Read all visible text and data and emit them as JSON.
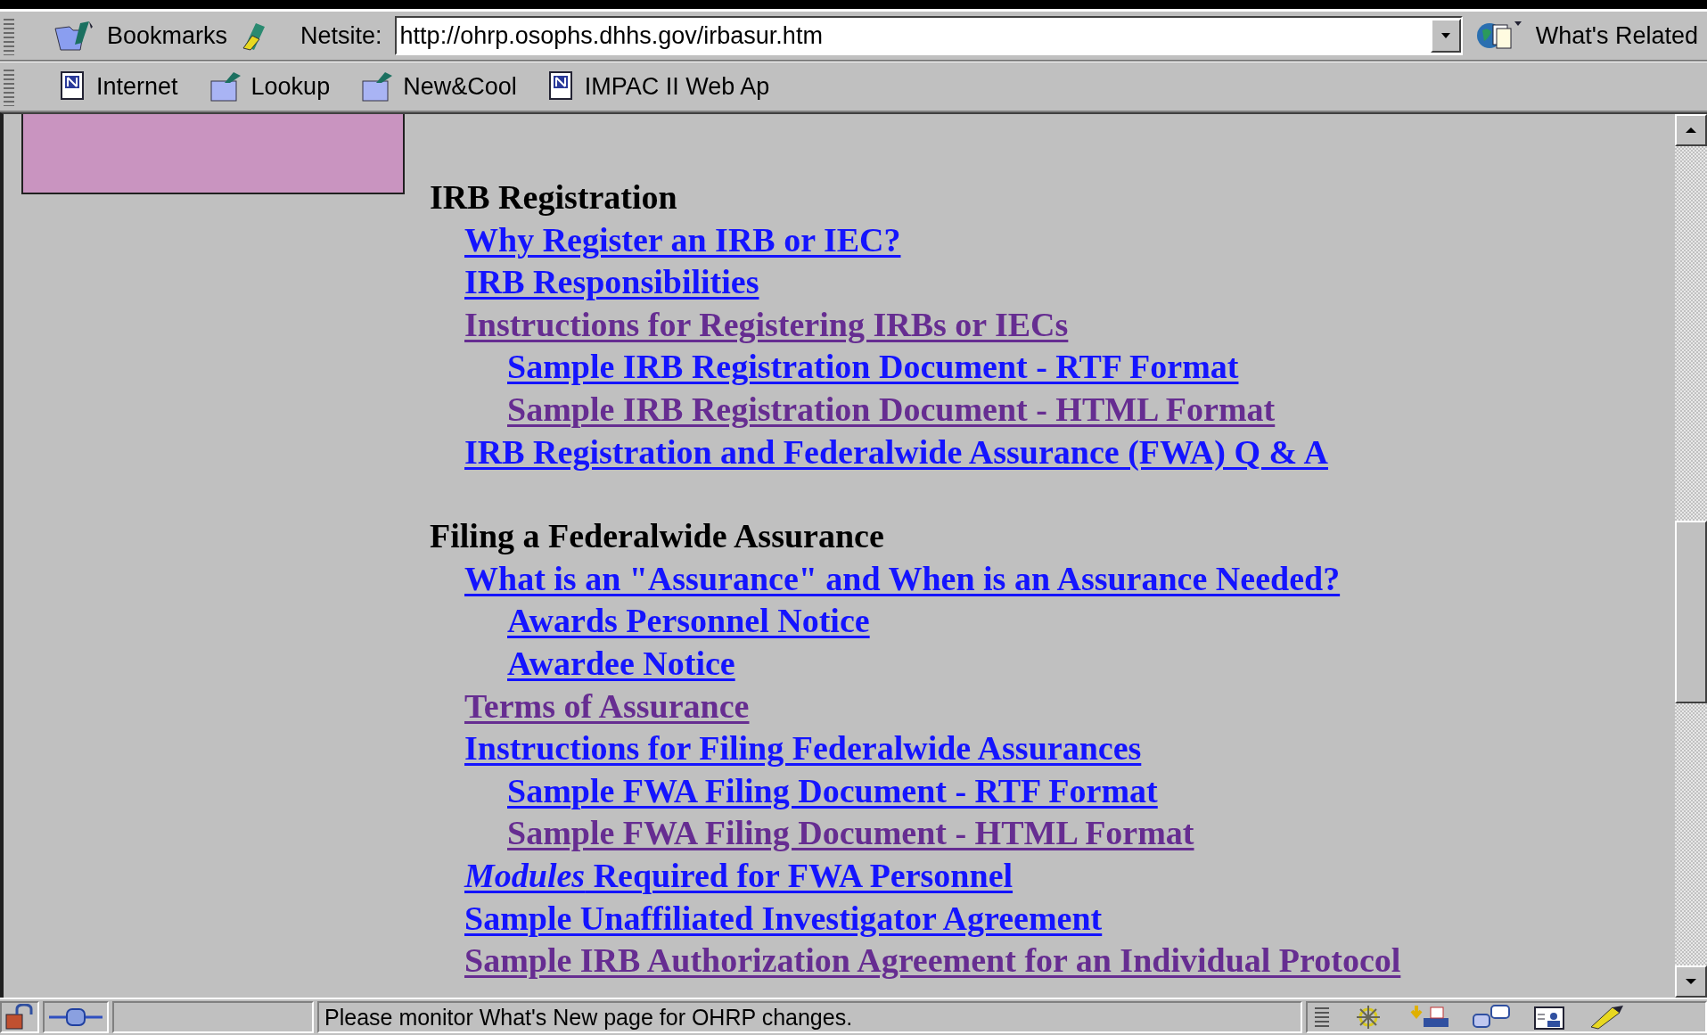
{
  "toolbar": {
    "bookmarks": "Bookmarks",
    "location_label": "Netsite:",
    "url": "http://ohrp.osophs.dhhs.gov/irbasur.htm",
    "whats_related": "What's Related"
  },
  "personal_toolbar": [
    "Internet",
    "Lookup",
    "New&Cool",
    "IMPAC II Web Ap"
  ],
  "sections": [
    {
      "heading": "IRB Registration",
      "links": [
        {
          "text": "Why Register an IRB or IEC?",
          "visited": false
        },
        {
          "text": "IRB Responsibilities",
          "visited": false
        },
        {
          "text": "Instructions for Registering IRBs or IECs",
          "visited": true,
          "children": [
            {
              "text": "Sample IRB Registration Document - RTF Format",
              "visited": false
            },
            {
              "text": "Sample IRB Registration Document - HTML Format",
              "visited": true
            }
          ]
        },
        {
          "text": "IRB Registration and Federalwide Assurance (FWA) Q & A",
          "visited": false
        }
      ]
    },
    {
      "heading": "Filing a Federalwide Assurance",
      "links": [
        {
          "text": "What is an \"Assurance\" and When is an Assurance Needed?",
          "visited": false,
          "children": [
            {
              "text": "Awards Personnel Notice",
              "visited": false
            },
            {
              "text": "Awardee Notice",
              "visited": false
            }
          ]
        },
        {
          "text": "Terms of Assurance",
          "visited": true
        },
        {
          "text": "Instructions for Filing Federalwide Assurances",
          "visited": false,
          "children": [
            {
              "text": "Sample FWA Filing Document - RTF Format",
              "visited": false
            },
            {
              "text": "Sample FWA Filing Document - HTML Format",
              "visited": true
            }
          ]
        },
        {
          "text": "*Modules* Required for FWA Personnel ",
          "visited": false
        },
        {
          "text": "Sample Unaffiliated Investigator Agreement",
          "visited": false
        },
        {
          "text": "Sample IRB Authorization Agreement for an Individual Protocol",
          "visited": true
        }
      ]
    }
  ],
  "status_bar": {
    "message": "Please monitor What's New page for OHRP changes."
  }
}
